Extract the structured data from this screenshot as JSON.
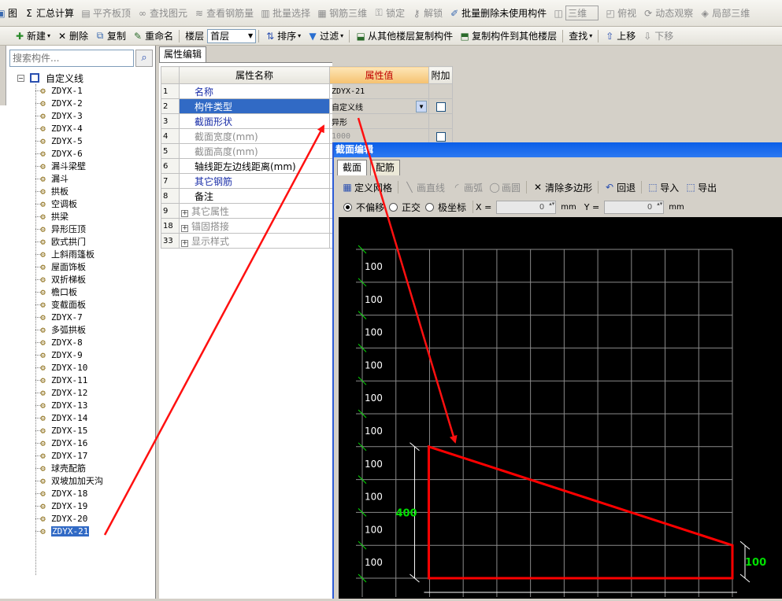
{
  "toolbar1": {
    "items": [
      {
        "icon": "map-icon",
        "label": "图",
        "enabled": true
      },
      {
        "icon": "sigma-icon",
        "label": "汇总计算",
        "enabled": true
      },
      {
        "icon": "align-icon",
        "label": "平齐板顶",
        "enabled": false
      },
      {
        "icon": "binoculars-icon",
        "label": "查找图元",
        "enabled": false
      },
      {
        "icon": "rebar-view-icon",
        "label": "查看钢筋量",
        "enabled": false
      },
      {
        "icon": "batch-select-icon",
        "label": "批量选择",
        "enabled": false
      },
      {
        "icon": "rebar-3d-icon",
        "label": "钢筋三维",
        "enabled": false
      },
      {
        "icon": "lock-icon",
        "label": "锁定",
        "enabled": false
      },
      {
        "icon": "unlock-icon",
        "label": "解锁",
        "enabled": false
      },
      {
        "icon": "batch-delete-icon",
        "label": "批量删除未使用构件",
        "enabled": true
      },
      {
        "icon": "3d-box-icon",
        "label": "三维",
        "enabled": false
      },
      {
        "icon": "top-view-icon",
        "label": "俯视",
        "enabled": false
      },
      {
        "icon": "orbit-icon",
        "label": "动态观察",
        "enabled": false
      },
      {
        "icon": "local-3d-icon",
        "label": "局部三维",
        "enabled": false
      }
    ]
  },
  "toolbar2": {
    "new_label": "新建",
    "delete_label": "删除",
    "copy_label": "复制",
    "rename_label": "重命名",
    "floor_label": "楼层",
    "floor_value": "首层",
    "sort_label": "排序",
    "filter_label": "过滤",
    "copy_from_label": "从其他楼层复制构件",
    "copy_to_label": "复制构件到其他楼层",
    "find_label": "查找",
    "move_up_label": "上移",
    "move_down_label": "下移"
  },
  "tree": {
    "search_placeholder": "搜索构件...",
    "root_label": "自定义线",
    "items": [
      "ZDYX-1",
      "ZDYX-2",
      "ZDYX-3",
      "ZDYX-4",
      "ZDYX-5",
      "ZDYX-6",
      "漏斗梁壁",
      "漏斗",
      "拱板",
      "空调板",
      "拱梁",
      "异形压顶",
      "欧式拱门",
      "上斜雨篷板",
      "屋面饰板",
      "双折梯板",
      "檐口板",
      "变截面板",
      "ZDYX-7",
      "多弧拱板",
      "ZDYX-8",
      "ZDYX-9",
      "ZDYX-10",
      "ZDYX-11",
      "ZDYX-12",
      "ZDYX-13",
      "ZDYX-14",
      "ZDYX-15",
      "ZDYX-16",
      "ZDYX-17",
      "球壳配筋",
      "双坡加加天沟",
      "ZDYX-18",
      "ZDYX-19",
      "ZDYX-20",
      "ZDYX-21"
    ],
    "selected_index": 35
  },
  "props": {
    "tab_label": "属性编辑",
    "header": {
      "name": "属性名称",
      "value": "属性值",
      "extra": "附加"
    },
    "rows": [
      {
        "num": "1",
        "name": "名称",
        "value": "ZDYX-21",
        "style": "blue",
        "check": false
      },
      {
        "num": "2",
        "name": "构件类型",
        "value": "自定义线",
        "style": "sel",
        "check": true
      },
      {
        "num": "3",
        "name": "截面形状",
        "value": "异形",
        "style": "blue",
        "check": false
      },
      {
        "num": "4",
        "name": "截面宽度(mm)",
        "value": "1000",
        "style": "gray",
        "check": true
      },
      {
        "num": "5",
        "name": "截面高度(mm)",
        "value": "",
        "style": "gray",
        "check": false
      },
      {
        "num": "6",
        "name": "轴线距左边线距离(mm)",
        "value": "",
        "style": "normal",
        "check": false
      },
      {
        "num": "7",
        "name": "其它钢筋",
        "value": "",
        "style": "blue",
        "check": false
      },
      {
        "num": "8",
        "name": "备注",
        "value": "",
        "style": "normal",
        "check": false
      },
      {
        "num": "9",
        "name": "其它属性",
        "value": "",
        "style": "group",
        "check": false
      },
      {
        "num": "18",
        "name": "锚固搭接",
        "value": "",
        "style": "group",
        "check": false
      },
      {
        "num": "33",
        "name": "显示样式",
        "value": "",
        "style": "group",
        "check": false
      }
    ]
  },
  "section_editor": {
    "title": "截面编辑",
    "tabs": [
      "截面",
      "配筋"
    ],
    "tools": {
      "define_grid": "定义网格",
      "draw_line": "画直线",
      "draw_arc": "画弧",
      "draw_circle": "画圆",
      "clear_polygon": "清除多边形",
      "undo": "回退",
      "import": "导入",
      "export": "导出"
    },
    "snap": {
      "no_offset": "不偏移",
      "ortho": "正交",
      "polar": "极坐标",
      "mode": "no_offset"
    },
    "coords": {
      "x_label": "X =",
      "x_value": "0",
      "y_label": "Y =",
      "y_value": "0",
      "unit": "mm"
    },
    "grid": {
      "row_labels": [
        "100",
        "100",
        "100",
        "100",
        "100",
        "100",
        "100",
        "100",
        "100",
        "100"
      ],
      "left_dim": "400",
      "right_dim": "100",
      "label_color": "#00e000",
      "polygon_color": "#ff0000"
    }
  },
  "colors": {
    "accent_blue": "#316ac5",
    "title_blue": "#0a5ee8",
    "arrow_red": "#ff1010"
  }
}
